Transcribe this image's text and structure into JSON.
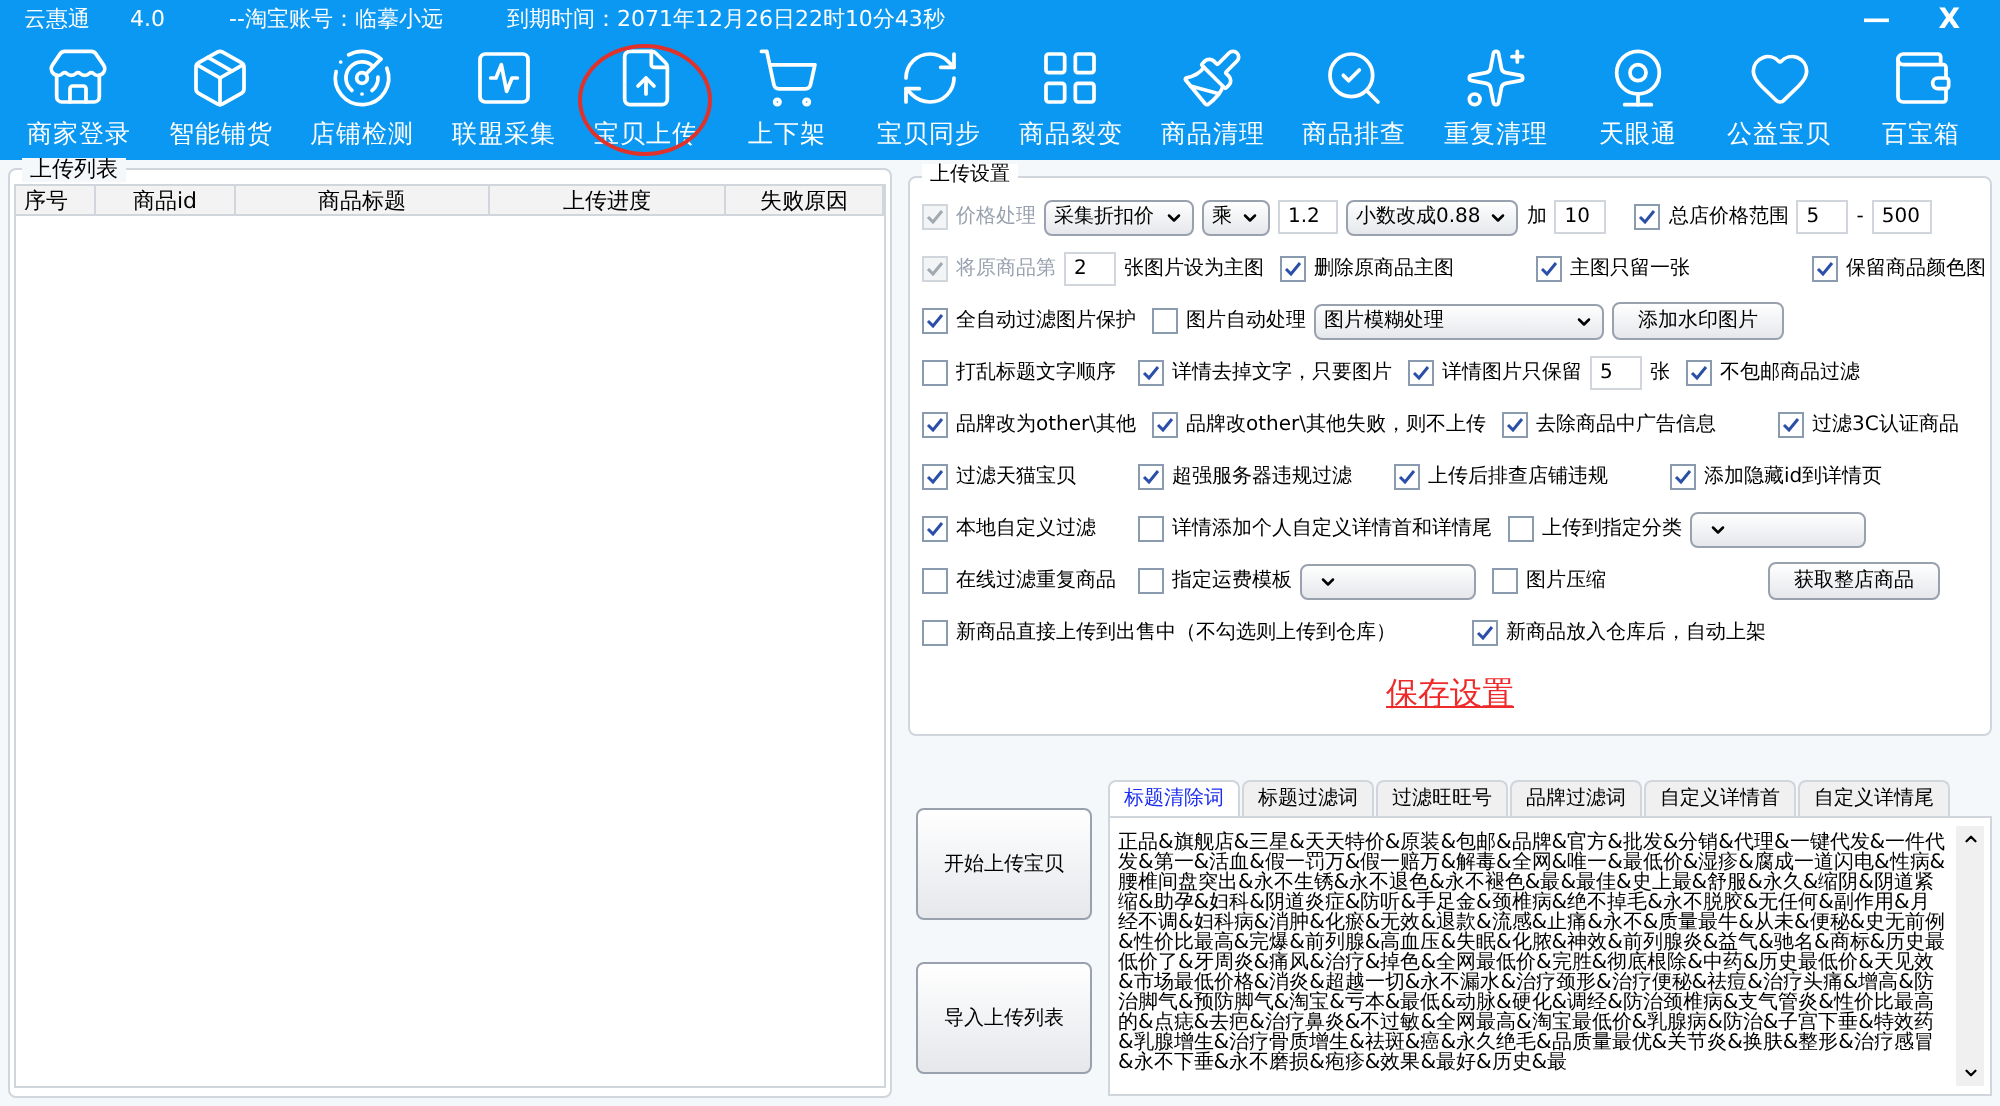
{
  "title_bar": {
    "app": "云惠通",
    "version": "4.0",
    "account": "--淘宝账号：临摹小远",
    "expiry": "到期时间：2071年12月26日22时10分43秒",
    "controls": [
      "—",
      "X"
    ]
  },
  "toolbar": [
    {
      "label": "商家登录",
      "circled": false
    },
    {
      "label": "智能铺货",
      "circled": false
    },
    {
      "label": "店铺检测",
      "circled": false
    },
    {
      "label": "联盟采集",
      "circled": false
    },
    {
      "label": "宝贝上传",
      "circled": true
    },
    {
      "label": "上下架",
      "circled": false
    },
    {
      "label": "宝贝同步",
      "circled": false
    },
    {
      "label": "商品裂变",
      "circled": false
    },
    {
      "label": "商品清理",
      "circled": false
    },
    {
      "label": "商品排查",
      "circled": false
    },
    {
      "label": "重复清理",
      "circled": false
    },
    {
      "label": "天眼通",
      "circled": false
    },
    {
      "label": "公益宝贝",
      "circled": false
    },
    {
      "label": "百宝箱",
      "circled": false
    }
  ],
  "upload_list": {
    "title": "上传列表",
    "columns": [
      "序号",
      "商品id",
      "商品标题",
      "上传进度",
      "失败原因"
    ]
  },
  "settings": {
    "title": "上传设置",
    "rows": [
      {
        "kind": "flow",
        "cells": [
          [
            {
              "kind": "checkbox",
              "label": "价格处理",
              "checked": true,
              "disabled": true
            },
            {
              "kind": "select",
              "value": "采集折扣价"
            },
            {
              "kind": "select",
              "value": "乘"
            },
            {
              "kind": "input",
              "value": "1.2"
            },
            {
              "kind": "select",
              "value": "小数改成0.88"
            },
            {
              "kind": "text",
              "value": "加"
            },
            {
              "kind": "input",
              "value": "10"
            },
            {
              "kind": "checkbox",
              "label": "总店价格范围",
              "checked": true,
              "disabled": false
            },
            {
              "kind": "input",
              "value": "5"
            },
            {
              "kind": "text",
              "value": "-"
            },
            {
              "kind": "input",
              "value": "500"
            }
          ]
        ]
      },
      {
        "kind": "grid",
        "cells": [
          [
            {
              "kind": "checkbox",
              "label": "将原商品第",
              "checked": true,
              "disabled": true
            },
            {
              "kind": "input",
              "value": "2"
            },
            {
              "kind": "text",
              "value": "张图片设为主图"
            }
          ],
          [
            {
              "kind": "checkbox",
              "label": "删除原商品主图",
              "checked": true,
              "disabled": false
            }
          ],
          [
            {
              "kind": "checkbox",
              "label": "主图只留一张",
              "checked": true,
              "disabled": false
            }
          ],
          [
            {
              "kind": "checkbox",
              "label": "保留商品颜色图",
              "checked": true,
              "disabled": false
            }
          ]
        ]
      },
      {
        "kind": "grid",
        "cells": [
          [
            {
              "kind": "checkbox",
              "label": "全自动过滤图片保护",
              "checked": true,
              "disabled": false
            }
          ],
          [
            {
              "kind": "checkbox",
              "label": "图片自动处理",
              "checked": false,
              "disabled": false
            },
            {
              "kind": "select",
              "value": "图片模糊处理"
            },
            {
              "kind": "button",
              "value": "添加水印图片"
            }
          ]
        ]
      },
      {
        "kind": "grid",
        "cells": [
          [
            {
              "kind": "checkbox",
              "label": "打乱标题文字顺序",
              "checked": false,
              "disabled": false
            }
          ],
          [
            {
              "kind": "checkbox",
              "label": "详情去掉文字，只要图片",
              "checked": true,
              "disabled": false
            }
          ],
          [
            {
              "kind": "checkbox",
              "label": "详情图片只保留",
              "checked": true,
              "disabled": false
            },
            {
              "kind": "input",
              "value": "5"
            },
            {
              "kind": "text",
              "value": "张"
            }
          ],
          [
            {
              "kind": "checkbox",
              "label": "不包邮商品过滤",
              "checked": true,
              "disabled": false
            }
          ]
        ]
      },
      {
        "kind": "grid",
        "cells": [
          [
            {
              "kind": "checkbox",
              "label": "品牌改为other\\其他",
              "checked": true,
              "disabled": false
            }
          ],
          [
            {
              "kind": "checkbox",
              "label": "品牌改other\\其他失败，则不上传",
              "checked": true,
              "disabled": false
            }
          ],
          [
            {
              "kind": "checkbox",
              "label": "去除商品中广告信息",
              "checked": true,
              "disabled": false
            }
          ],
          [
            {
              "kind": "checkbox",
              "label": "过滤3C认证商品",
              "checked": true,
              "disabled": false
            }
          ]
        ]
      },
      {
        "kind": "grid",
        "cells": [
          [
            {
              "kind": "checkbox",
              "label": "过滤天猫宝贝",
              "checked": true,
              "disabled": false
            }
          ],
          [
            {
              "kind": "checkbox",
              "label": "超强服务器违规过滤",
              "checked": true,
              "disabled": false
            }
          ],
          [
            {
              "kind": "checkbox",
              "label": "上传后排查店铺违规",
              "checked": true,
              "disabled": false
            }
          ],
          [
            {
              "kind": "checkbox",
              "label": "添加隐藏id到详情页",
              "checked": true,
              "disabled": false
            }
          ]
        ]
      },
      {
        "kind": "grid",
        "cells": [
          [
            {
              "kind": "checkbox",
              "label": "本地自定义过滤",
              "checked": true,
              "disabled": false
            }
          ],
          [
            {
              "kind": "checkbox",
              "label": "详情添加个人自定义详情首和详情尾",
              "checked": false,
              "disabled": false
            }
          ],
          [
            {
              "kind": "checkbox",
              "label": "上传到指定分类",
              "checked": false,
              "disabled": false
            },
            {
              "kind": "select"
            }
          ]
        ]
      },
      {
        "kind": "grid",
        "cells": [
          [
            {
              "kind": "checkbox",
              "label": "在线过滤重复商品",
              "checked": false,
              "disabled": false
            }
          ],
          [
            {
              "kind": "checkbox",
              "label": "指定运费模板",
              "checked": false,
              "disabled": false
            },
            {
              "kind": "select"
            }
          ],
          [
            {
              "kind": "checkbox",
              "label": "图片压缩",
              "checked": false,
              "disabled": false
            }
          ],
          [
            {
              "kind": "button",
              "value": "获取整店商品"
            }
          ]
        ]
      },
      {
        "kind": "wide",
        "cells": [
          [
            {
              "kind": "checkbox",
              "label": "新商品直接上传到出售中（不勾选则上传到仓库）",
              "checked": false,
              "disabled": false
            }
          ],
          [
            {
              "kind": "checkbox",
              "label": "新商品放入仓库后，自动上架",
              "checked": true,
              "disabled": false
            }
          ]
        ]
      }
    ],
    "save": "保存设置"
  },
  "actions": [
    "开始上传宝贝",
    "导入上传列表"
  ],
  "word_tabs": [
    {
      "label": "标题清除词",
      "selected": true
    },
    {
      "label": "标题过滤词",
      "selected": false
    },
    {
      "label": "过滤旺旺号",
      "selected": false
    },
    {
      "label": "品牌过滤词",
      "selected": false
    },
    {
      "label": "自定义详情首",
      "selected": false
    },
    {
      "label": "自定义详情尾",
      "selected": false
    }
  ],
  "word_text": "正品&旗舰店&三星&天天特价&原装&包邮&品牌&官方&批发&分销&代理&一键代发&一件代发&第一&活血&假一罚万&假一赔万&解毒&全网&唯一&最低价&湿疹&腐成一道闪电&性病&腰椎间盘突出&永不生锈&永不退色&永不褪色&最&最佳&史上最&舒服&永久&缩阴&阴道紧缩&助孕&妇科&阴道炎症&防听&手足金&颈椎病&绝不掉毛&永不脱胶&无任何&副作用&月经不调&妇科病&消肿&化瘀&无效&退款&流感&止痛&永不&质量最牛&从未&便秘&史无前例&性价比最高&完爆&前列腺&高血压&失眠&化脓&神效&前列腺炎&益气&驰名&商标&历史最低价了&牙周炎&痛风&治疗&掉色&全网最低价&完胜&彻底根除&中药&历史最低价&天见效&市场最低价格&消炎&超越一切&永不漏水&治疗颈形&治疗便秘&祛痘&治疗头痛&增高&防治脚气&预防脚气&淘宝&亏本&最低&动脉&硬化&调经&防治颈椎病&支气管炎&性价比最高的&点痣&去疤&治疗鼻炎&不过敏&全网最高&淘宝最低价&乳腺病&防治&子宫下垂&特效药&乳腺增生&治疗骨质增生&祛斑&癌&永久绝毛&品质量最优&关节炎&换肤&整形&治疗感冒&永不下垂&永不磨损&疱疹&效果&最好&历史&最"
}
